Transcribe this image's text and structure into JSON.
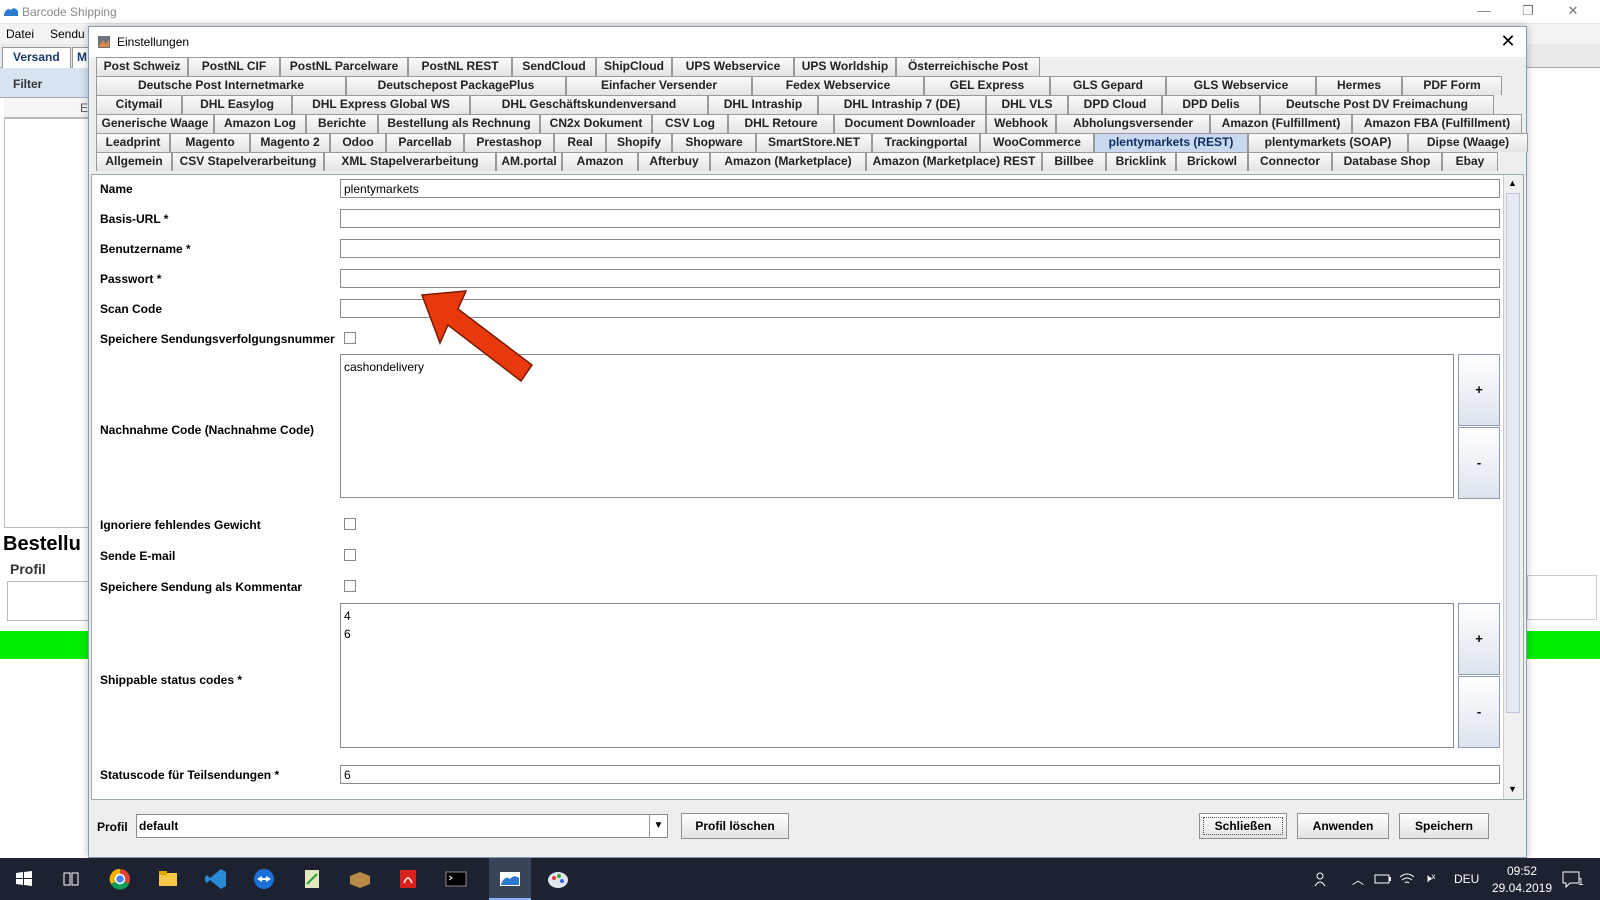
{
  "app": {
    "title": "Barcode Shipping",
    "menu": [
      "Datei",
      "Sendu"
    ],
    "tabs": [
      "Versand",
      "M"
    ],
    "filter_label": "Filter",
    "column_stub": "E",
    "heading_stub": "Bestellu",
    "profil_stub": "Profil"
  },
  "dialog": {
    "title": "Einstellungen",
    "close_glyph": "✕",
    "tab_rows": [
      [
        "Post Schweiz",
        "PostNL CIF",
        "PostNL Parcelware",
        "PostNL REST",
        "SendCloud",
        "ShipCloud",
        "UPS Webservice",
        "UPS Worldship",
        "Österreichische Post"
      ],
      [
        "Deutsche Post Internetmarke",
        "Deutschepost PackagePlus",
        "Einfacher Versender",
        "Fedex Webservice",
        "GEL Express",
        "GLS Gepard",
        "GLS Webservice",
        "Hermes",
        "PDF Form"
      ],
      [
        "Citymail",
        "DHL Easylog",
        "DHL Express Global WS",
        "DHL Geschäftskundenversand",
        "DHL Intraship",
        "DHL Intraship 7 (DE)",
        "DHL VLS",
        "DPD Cloud",
        "DPD Delis",
        "Deutsche Post DV Freimachung"
      ],
      [
        "Generische Waage",
        "Amazon Log",
        "Berichte",
        "Bestellung als Rechnung",
        "CN2x Dokument",
        "CSV Log",
        "DHL Retoure",
        "Document Downloader",
        "Webhook",
        "Abholungsversender",
        "Amazon (Fulfillment)",
        "Amazon FBA (Fulfillment)"
      ],
      [
        "Leadprint",
        "Magento",
        "Magento 2",
        "Odoo",
        "Parcellab",
        "Prestashop",
        "Real",
        "Shopify",
        "Shopware",
        "SmartStore.NET",
        "Trackingportal",
        "WooCommerce",
        "plentymarkets (REST)",
        "plentymarkets (SOAP)",
        "Dipse (Waage)"
      ],
      [
        "Allgemein",
        "CSV Stapelverarbeitung",
        "XML Stapelverarbeitung",
        "AM.portal",
        "Amazon",
        "Afterbuy",
        "Amazon (Marketplace)",
        "Amazon (Marketplace) REST",
        "Billbee",
        "Bricklink",
        "Brickowl",
        "Connector",
        "Database Shop",
        "Ebay"
      ]
    ],
    "active_tab": "plentymarkets (REST)",
    "form": {
      "name_label": "Name",
      "name_value": "plentymarkets",
      "baseurl_label": "Basis-URL *",
      "baseurl_value": "",
      "username_label": "Benutzername *",
      "username_value": "",
      "password_label": "Passwort *",
      "password_value": "",
      "scancode_label": "Scan Code",
      "scancode_value": "",
      "save_tracking_label": "Speichere Sendungsverfolgungsnummer",
      "save_tracking_checked": false,
      "cod_label": "Nachnahme Code (Nachnahme Code)",
      "cod_values": [
        "cashondelivery"
      ],
      "ignore_weight_label": "Ignoriere fehlendes Gewicht",
      "ignore_weight_checked": false,
      "send_email_label": "Sende E-mail",
      "send_email_checked": false,
      "save_comment_label": "Speichere Sendung als Kommentar",
      "save_comment_checked": false,
      "status_codes_label": "Shippable status codes *",
      "status_codes_values": [
        "4",
        "6"
      ],
      "partial_status_label": "Statuscode für Teilsendungen *",
      "partial_status_value": "6",
      "add_glyph": "+",
      "remove_glyph": "-"
    },
    "footer": {
      "profil_label": "Profil",
      "profil_value": "default",
      "delete_profile": "Profil löschen",
      "close": "Schließen",
      "apply": "Anwenden",
      "save": "Speichern"
    }
  },
  "taskbar": {
    "icons": [
      "windows-start-icon",
      "task-view-icon",
      "chrome-icon",
      "file-explorer-icon",
      "vscode-icon",
      "teamviewer-icon",
      "notepad-icon",
      "package-icon",
      "acrobat-icon",
      "terminal-icon",
      "barcode-shipping-icon",
      "paint-icon"
    ],
    "lang": "DEU",
    "time": "09:52",
    "date": "29.04.2019",
    "notification_count": "1"
  },
  "colors": {
    "arrow": "#e8380d",
    "active_tab": "#c9daf0",
    "green_bar": "#00ee00",
    "taskbar": "#1c2230"
  }
}
